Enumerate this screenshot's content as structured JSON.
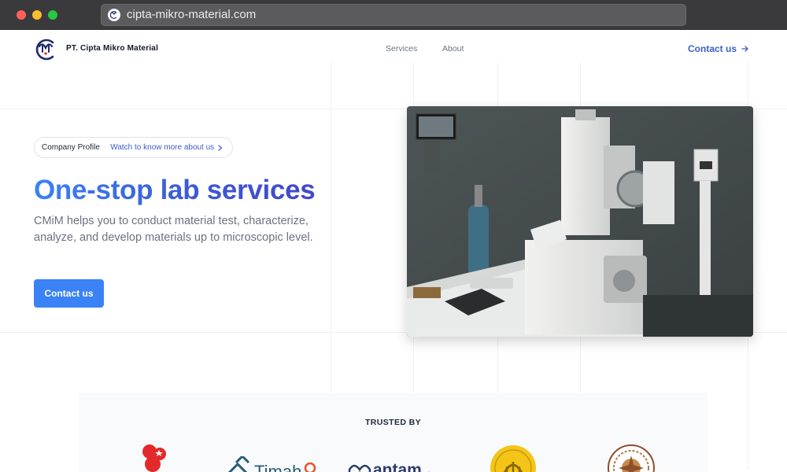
{
  "browser": {
    "url": "cipta-mikro-material.com"
  },
  "nav": {
    "brand": "PT. Cipta Mikro Material",
    "links": [
      "Services",
      "About"
    ],
    "contact_label": "Contact us"
  },
  "hero": {
    "pill_label": "Company Profile",
    "pill_link": "Watch to know more about us",
    "title": "One-stop lab services",
    "description": "CMiM helps you to conduct material test, characterize, analyze, and develop materials up to microscopic level.",
    "cta_label": "Contact us"
  },
  "trusted": {
    "title": "TRUSTED BY",
    "clients": [
      {
        "icon": "red-circles-logo",
        "text": ""
      },
      {
        "icon": "timah-logo",
        "text": "Timah"
      },
      {
        "icon": "antam-logo",
        "text": "antam"
      },
      {
        "icon": "yellow-emblem-logo",
        "text": ""
      },
      {
        "icon": "brown-seal-logo",
        "text": ""
      }
    ]
  },
  "colors": {
    "accent": "#3b82f6",
    "link": "#3b5ec6",
    "title": "#3b5bd6"
  }
}
